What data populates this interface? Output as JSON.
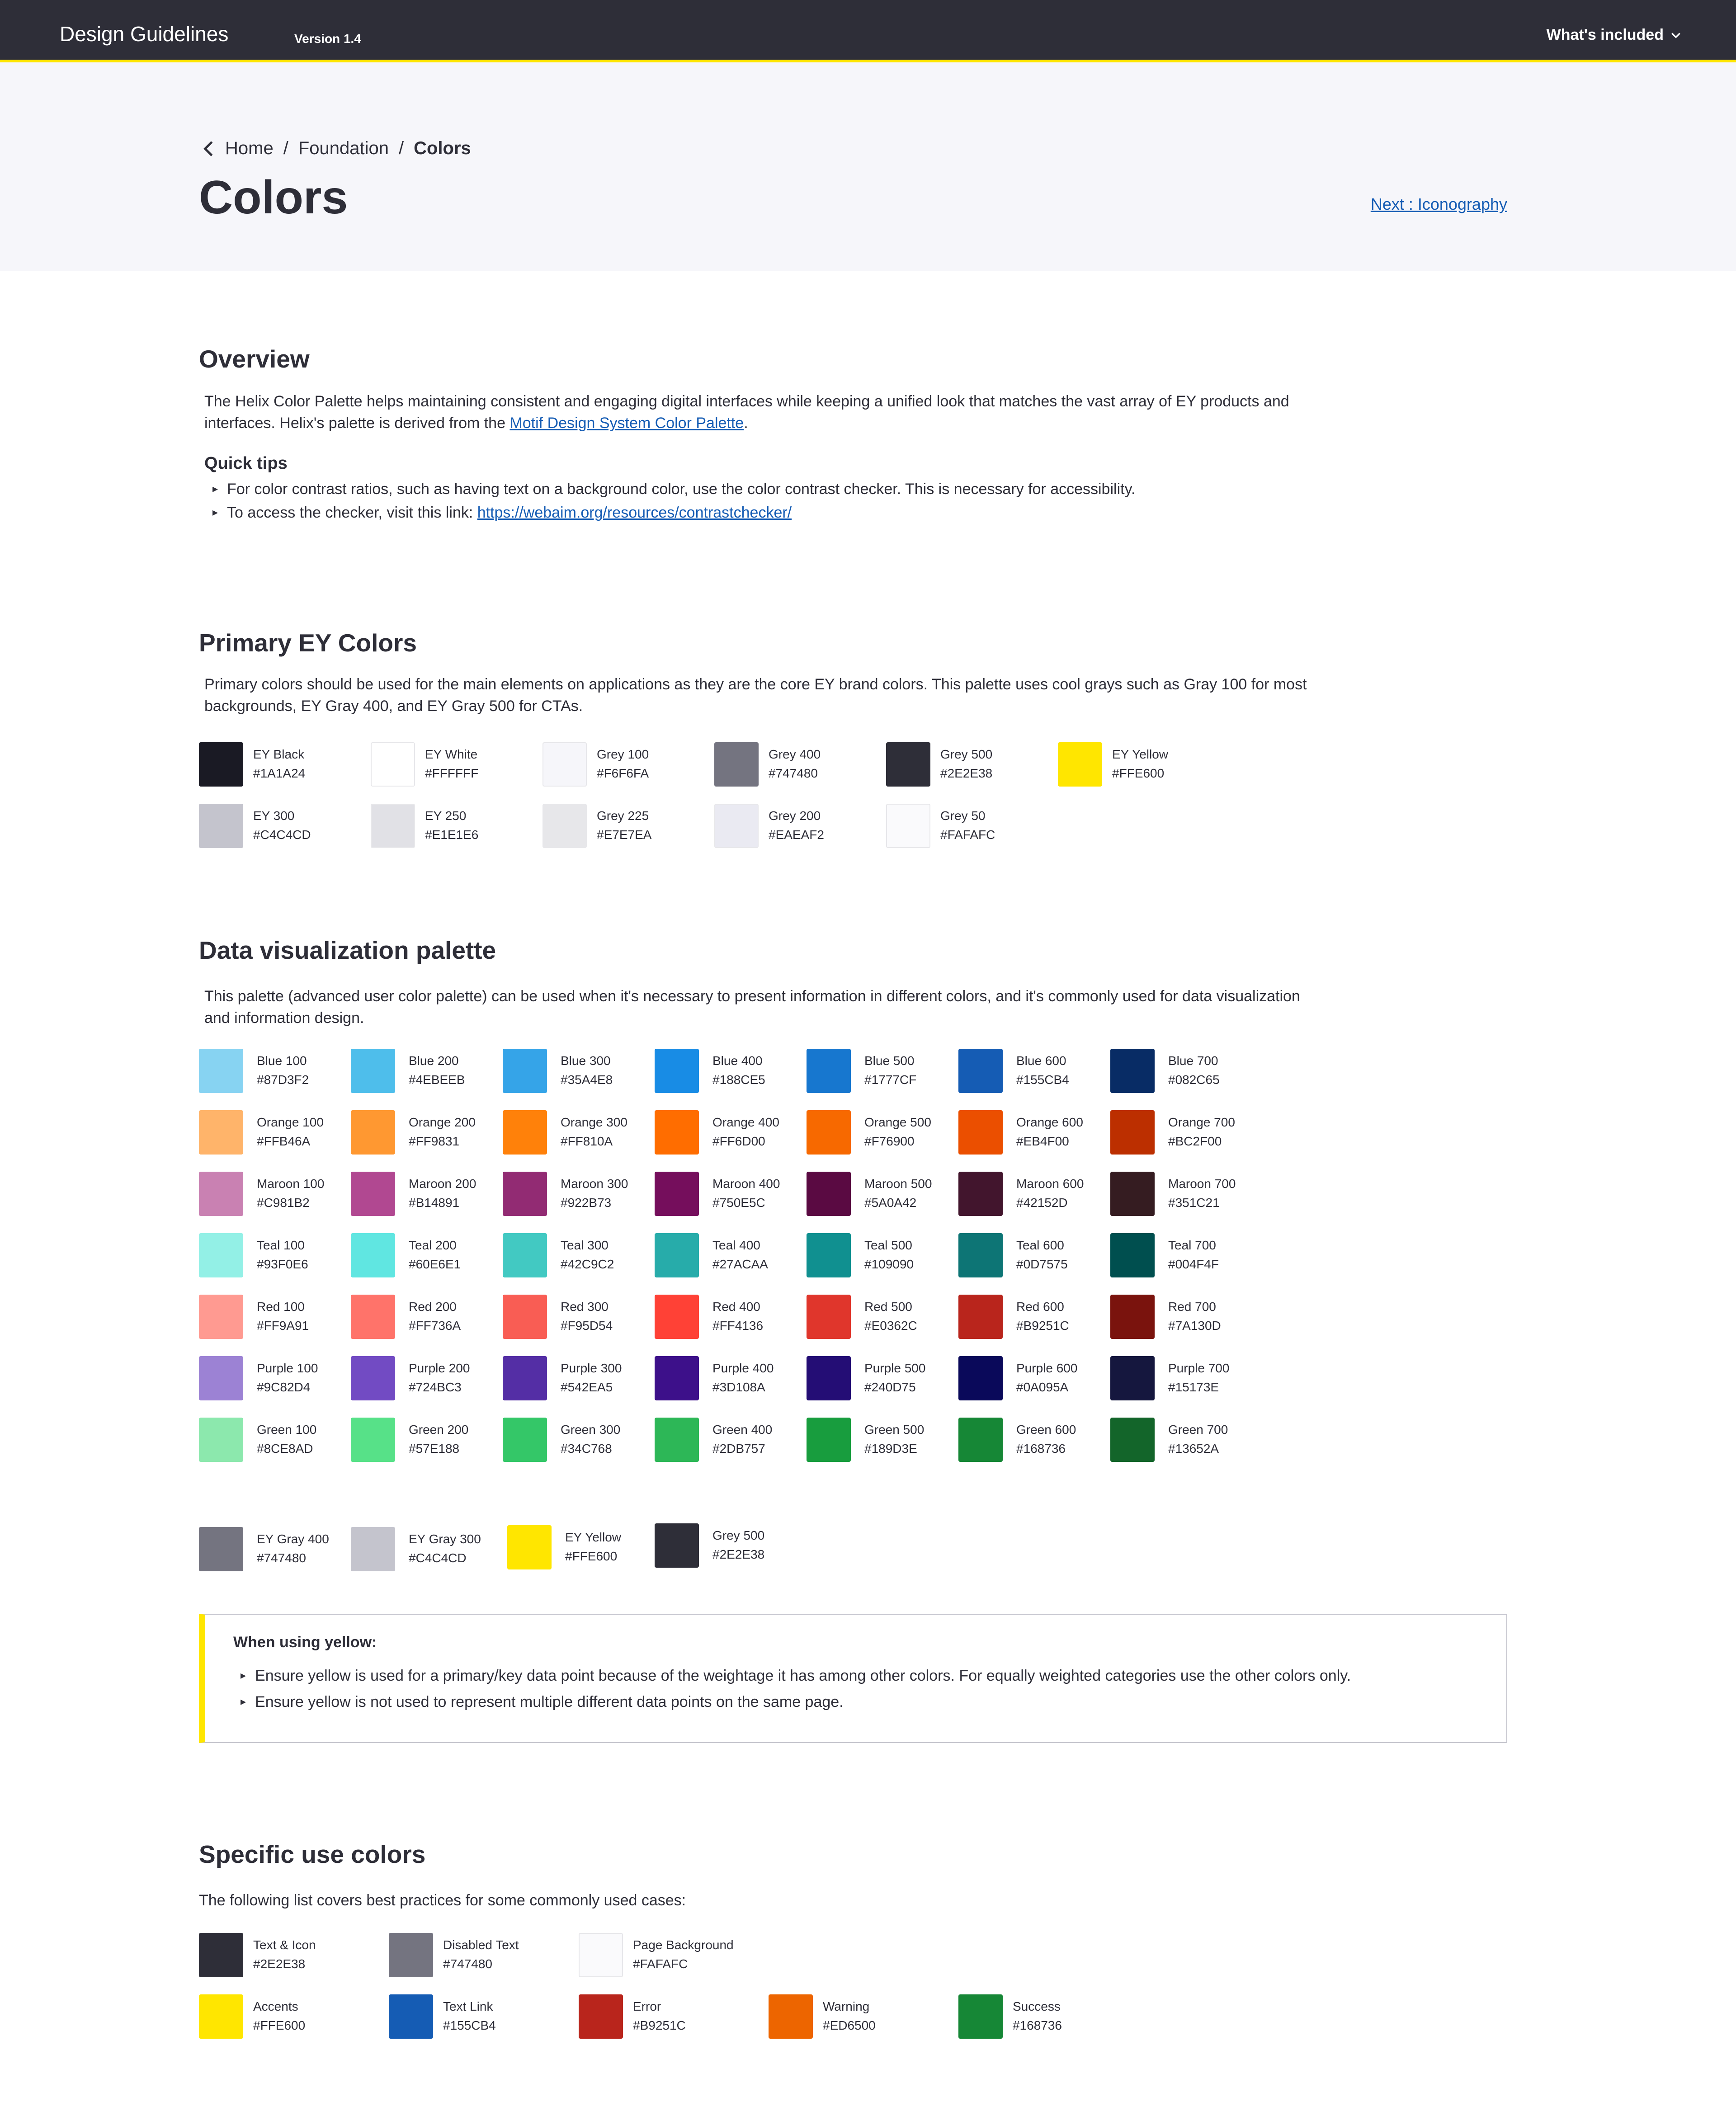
{
  "header": {
    "title": "Design Guidelines",
    "version": "Version 1.4",
    "menu_label": "What's included"
  },
  "breadcrumb": {
    "home": "Home",
    "section": "Foundation",
    "current": "Colors",
    "sep": "/"
  },
  "page": {
    "title": "Colors",
    "next_link": "Next : Iconography"
  },
  "overview": {
    "heading": "Overview",
    "text_before_link": "The Helix Color Palette helps maintaining consistent and engaging digital interfaces while keeping a unified look that matches the vast array of EY products and interfaces. Helix's palette is derived from the ",
    "link": "Motif Design System Color Palette",
    "text_after_link": ".",
    "quick_tips_title": "Quick tips",
    "tip1": "For color contrast ratios, such as having text on a background color, use the color contrast checker. This is necessary for accessibility.",
    "tip2_prefix": "To access the checker, visit this link: ",
    "tip2_link": "https://webaim.org/resources/contrastchecker/"
  },
  "primary": {
    "heading": "Primary EY Colors",
    "description": "Primary colors should be used for the main elements on applications as they are the core EY brand colors. This palette uses cool grays such as Gray 100 for most backgrounds, EY Gray 400, and EY Gray 500 for CTAs.",
    "rows": [
      [
        {
          "name": "EY Black",
          "hex": "#1A1A24"
        },
        {
          "name": "EY White",
          "hex": "#FFFFFF"
        },
        {
          "name": "Grey 100",
          "hex": "#F6F6FA"
        },
        {
          "name": "Grey 400",
          "hex": "#747480"
        },
        {
          "name": "Grey 500",
          "hex": "#2E2E38"
        },
        {
          "name": "EY Yellow",
          "hex": "#FFE600"
        }
      ],
      [
        {
          "name": "EY 300",
          "hex": "#C4C4CD"
        },
        {
          "name": "EY 250",
          "hex": "#E1E1E6"
        },
        {
          "name": "Grey 225",
          "hex": "#E7E7EA"
        },
        {
          "name": "Grey 200",
          "hex": "#EAEAF2"
        },
        {
          "name": "Grey 50",
          "hex": "#FAFAFC"
        }
      ]
    ]
  },
  "dataviz": {
    "heading": "Data visualization palette",
    "description": "This palette (advanced user color palette) can be used when it's necessary to present information in different colors, and it's commonly used for data visualization and information design.",
    "rows": [
      [
        {
          "name": "Blue 100",
          "hex": "#87D3F2"
        },
        {
          "name": "Blue 200",
          "hex": "#4EBEEB"
        },
        {
          "name": "Blue 300",
          "hex": "#35A4E8"
        },
        {
          "name": "Blue 400",
          "hex": "#188CE5"
        },
        {
          "name": "Blue 500",
          "hex": "#1777CF"
        },
        {
          "name": "Blue 600",
          "hex": "#155CB4"
        },
        {
          "name": "Blue 700",
          "hex": "#082C65"
        }
      ],
      [
        {
          "name": "Orange 100",
          "hex": "#FFB46A"
        },
        {
          "name": "Orange 200",
          "hex": "#FF9831"
        },
        {
          "name": "Orange 300",
          "hex": "#FF810A"
        },
        {
          "name": "Orange 400",
          "hex": "#FF6D00"
        },
        {
          "name": "Orange 500",
          "hex": "#F76900"
        },
        {
          "name": "Orange 600",
          "hex": "#EB4F00"
        },
        {
          "name": "Orange 700",
          "hex": "#BC2F00"
        }
      ],
      [
        {
          "name": "Maroon 100",
          "hex": "#C981B2"
        },
        {
          "name": "Maroon 200",
          "hex": "#B14891"
        },
        {
          "name": "Maroon 300",
          "hex": "#922B73"
        },
        {
          "name": "Maroon 400",
          "hex": "#750E5C"
        },
        {
          "name": "Maroon 500",
          "hex": "#5A0A42"
        },
        {
          "name": "Maroon 600",
          "hex": "#42152D"
        },
        {
          "name": "Maroon 700",
          "hex": "#351C21"
        }
      ],
      [
        {
          "name": "Teal 100",
          "hex": "#93F0E6"
        },
        {
          "name": "Teal 200",
          "hex": "#60E6E1"
        },
        {
          "name": "Teal 300",
          "hex": "#42C9C2"
        },
        {
          "name": "Teal 400",
          "hex": "#27ACAA"
        },
        {
          "name": "Teal 500",
          "hex": "#109090"
        },
        {
          "name": "Teal 600",
          "hex": "#0D7575"
        },
        {
          "name": "Teal 700",
          "hex": "#004F4F"
        }
      ],
      [
        {
          "name": "Red 100",
          "hex": "#FF9A91"
        },
        {
          "name": "Red 200",
          "hex": "#FF736A"
        },
        {
          "name": "Red 300",
          "hex": "#F95D54"
        },
        {
          "name": "Red 400",
          "hex": "#FF4136"
        },
        {
          "name": "Red 500",
          "hex": "#E0362C"
        },
        {
          "name": "Red 600",
          "hex": "#B9251C"
        },
        {
          "name": "Red 700",
          "hex": "#7A130D"
        }
      ],
      [
        {
          "name": "Purple 100",
          "hex": "#9C82D4"
        },
        {
          "name": "Purple 200",
          "hex": "#724BC3"
        },
        {
          "name": "Purple 300",
          "hex": "#542EA5"
        },
        {
          "name": "Purple 400",
          "hex": "#3D108A"
        },
        {
          "name": "Purple 500",
          "hex": "#240D75"
        },
        {
          "name": "Purple 600",
          "hex": "#0A095A"
        },
        {
          "name": "Purple 700",
          "hex": "#15173E"
        }
      ],
      [
        {
          "name": "Green 100",
          "hex": "#8CE8AD"
        },
        {
          "name": "Green 200",
          "hex": "#57E188"
        },
        {
          "name": "Green 300",
          "hex": "#34C768"
        },
        {
          "name": "Green 400",
          "hex": "#2DB757"
        },
        {
          "name": "Green 500",
          "hex": "#189D3E"
        },
        {
          "name": "Green 600",
          "hex": "#168736"
        },
        {
          "name": "Green 700",
          "hex": "#13652A"
        }
      ]
    ],
    "extra": [
      {
        "name": "EY Gray 400",
        "hex": "#747480"
      },
      {
        "name": "EY Gray 300",
        "hex": "#C4C4CD"
      },
      {
        "name": "EY Yellow",
        "hex": "#FFE600"
      },
      {
        "name": "Grey 500",
        "hex": "#2E2E38"
      }
    ]
  },
  "yellow_note": {
    "title": "When using yellow:",
    "items": [
      "Ensure yellow is used for a primary/key data point because of the weightage it has among other colors. For equally weighted categories use the other colors only.",
      "Ensure yellow is not used to represent multiple different data points on the same page."
    ]
  },
  "specific": {
    "heading": "Specific use colors",
    "description": "The following list covers best practices for some commonly used cases:",
    "rows": [
      [
        {
          "name": "Text & Icon",
          "hex": "#2E2E38"
        },
        {
          "name": "Disabled Text",
          "hex": "#747480"
        },
        {
          "name": "Page Background",
          "hex": "#FAFAFC"
        }
      ],
      [
        {
          "name": "Accents",
          "hex": "#FFE600"
        },
        {
          "name": "Text Link",
          "hex": "#155CB4"
        },
        {
          "name": "Error",
          "hex": "#B9251C"
        },
        {
          "name": "Warning",
          "hex": "#ED6500"
        },
        {
          "name": "Success",
          "hex": "#168736"
        }
      ]
    ]
  }
}
